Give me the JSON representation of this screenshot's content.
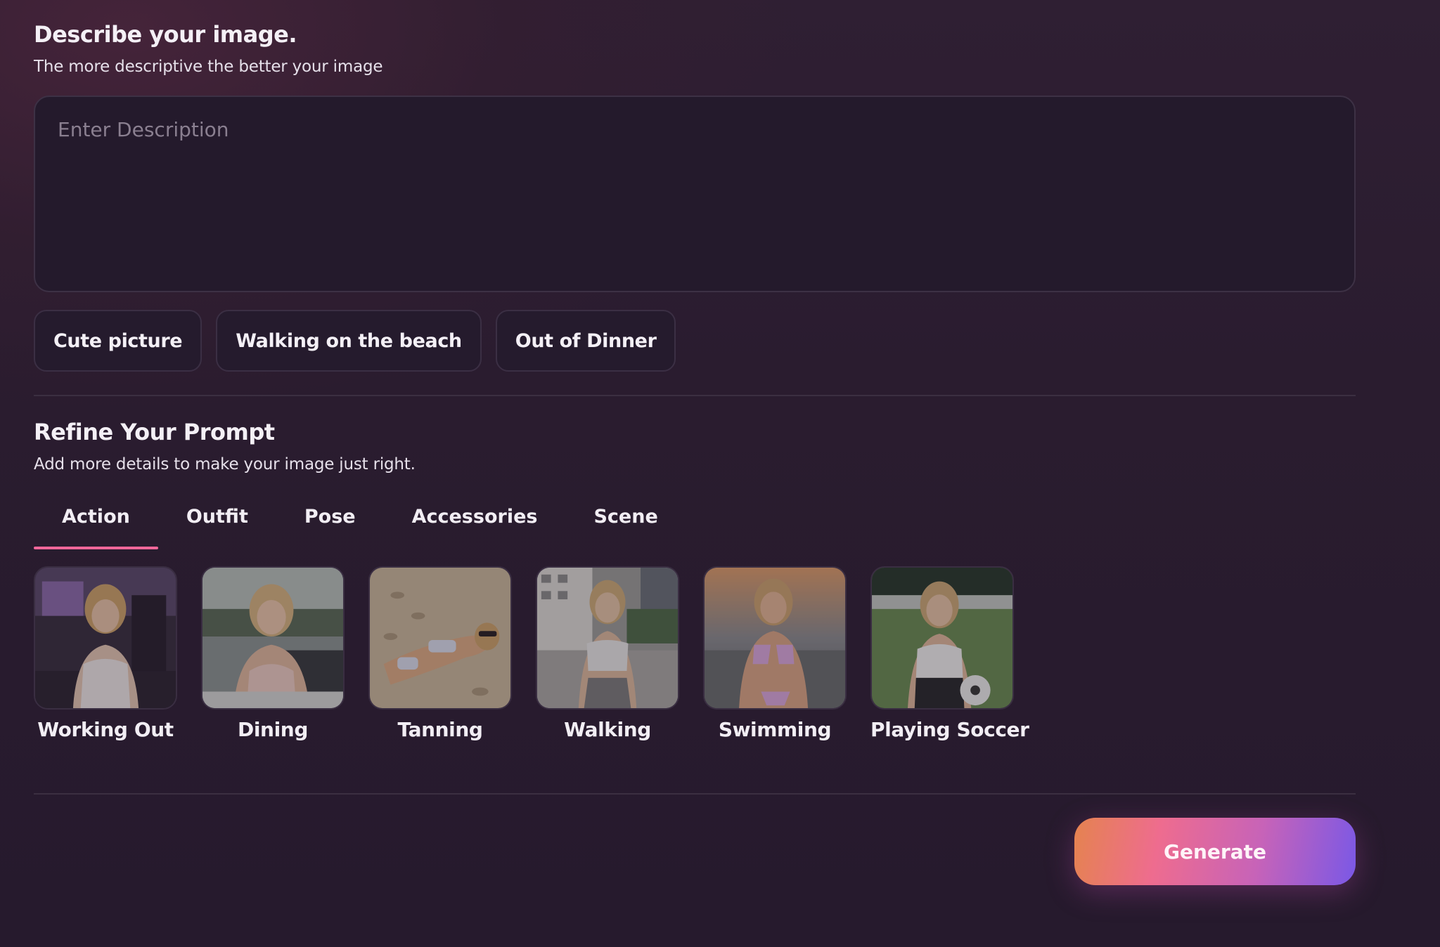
{
  "describe": {
    "title": "Describe your image.",
    "subtitle": "The more descriptive the better your image",
    "input_placeholder": "Enter Description",
    "input_value": ""
  },
  "suggestions": [
    {
      "label": "Cute picture"
    },
    {
      "label": "Walking on the beach"
    },
    {
      "label": "Out of Dinner"
    }
  ],
  "refine": {
    "title": "Refine Your Prompt",
    "subtitle": "Add more details to make your image just right.",
    "tabs": [
      {
        "label": "Action",
        "active": true
      },
      {
        "label": "Outfit",
        "active": false
      },
      {
        "label": "Pose",
        "active": false
      },
      {
        "label": "Accessories",
        "active": false
      },
      {
        "label": "Scene",
        "active": false
      }
    ],
    "options": [
      {
        "label": "Working Out",
        "image": "gym-photo"
      },
      {
        "label": "Dining",
        "image": "restaurant-photo"
      },
      {
        "label": "Tanning",
        "image": "sand-beach-photo"
      },
      {
        "label": "Walking",
        "image": "plaza-photo"
      },
      {
        "label": "Swimming",
        "image": "sunset-sea-photo"
      },
      {
        "label": "Playing Soccer",
        "image": "soccer-field-photo"
      }
    ]
  },
  "generate": {
    "label": "Generate"
  },
  "colors": {
    "accent_pink": "#f0679a",
    "button_gradient": [
      "#e5834f",
      "#ee6c8f",
      "#c763b8",
      "#7a58e6"
    ],
    "background": "#2a1c2f"
  }
}
